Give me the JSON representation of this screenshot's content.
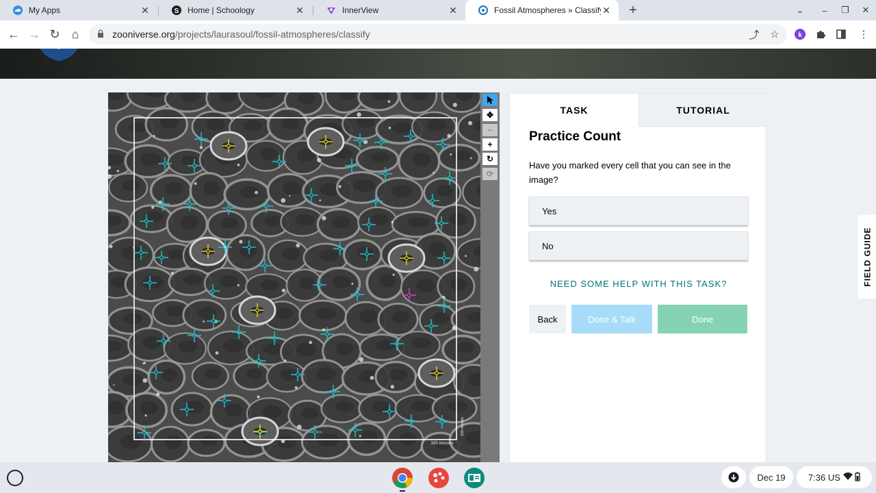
{
  "tabs": [
    {
      "title": "My Apps",
      "active": false
    },
    {
      "title": "Home | Schoology",
      "active": false
    },
    {
      "title": "InnerView",
      "active": false
    },
    {
      "title": "Fossil Atmospheres » Classify",
      "active": true
    }
  ],
  "address": {
    "host": "zooniverse.org",
    "path": "/projects/laurasoul/fossil-atmospheres/classify"
  },
  "viewer": {
    "scale_label": "100 microns",
    "scale_label_side": "100 microns"
  },
  "panel": {
    "tab_task": "TASK",
    "tab_tutorial": "TUTORIAL",
    "title": "Practice Count",
    "question": "Have you marked every cell that you can see in the image?",
    "answers": [
      "Yes",
      "No"
    ],
    "help": "NEED SOME HELP WITH THIS TASK?",
    "back": "Back",
    "done_talk": "Done & Talk",
    "done": "Done"
  },
  "field_guide": "FIELD GUIDE",
  "shelf": {
    "date": "Dec 19",
    "time": "7:36",
    "locale": "US"
  },
  "colors": {
    "cell_marker": "#19c6d6",
    "stomata_marker": "#e6d319",
    "other_marker": "#d63fd6",
    "help_link": "#00727b",
    "done_button": "#86d3b4",
    "done_talk_button": "#a6dcf8",
    "active_tool": "#3fa6f3"
  }
}
